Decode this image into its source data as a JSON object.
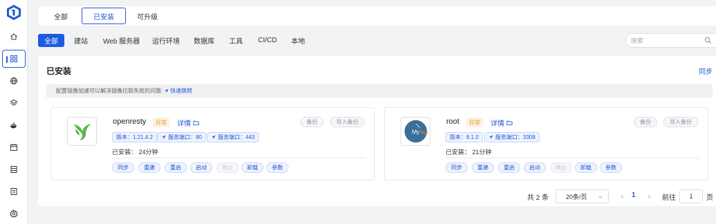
{
  "sidebar": {
    "items": [
      {
        "icon": "home-icon"
      },
      {
        "icon": "apps-grid-icon",
        "active": true
      },
      {
        "icon": "globe-icon"
      },
      {
        "icon": "layers-icon"
      },
      {
        "icon": "docker-icon"
      },
      {
        "icon": "calendar-icon"
      },
      {
        "icon": "database-icon"
      },
      {
        "icon": "log-icon"
      },
      {
        "icon": "settings-icon"
      }
    ]
  },
  "top_tabs": [
    {
      "label": "全部"
    },
    {
      "label": "已安装",
      "active": true
    },
    {
      "label": "可升级"
    }
  ],
  "filters": [
    {
      "label": "全部",
      "active": true
    },
    {
      "label": "建站"
    },
    {
      "label": "Web 服务器"
    },
    {
      "label": "运行环境"
    },
    {
      "label": "数据库"
    },
    {
      "label": "工具"
    },
    {
      "label": "CI/CD"
    },
    {
      "label": "本地"
    }
  ],
  "search": {
    "placeholder": "搜索"
  },
  "panel": {
    "title": "已安装",
    "sync": "同步",
    "tip": "配置镜像加速可以解决镜像拉取失败的问题",
    "tip_link": "快速跳转"
  },
  "apps": [
    {
      "name": "openresty",
      "status": "异常",
      "detail": "详情",
      "version": "版本：1.21.4.2",
      "ports": [
        "服务端口：80",
        "服务端口：443"
      ],
      "installed": "已安装：  24分钟",
      "backup": "备份",
      "import_backup": "导入备份",
      "actions": [
        "同步",
        "重建",
        "重启",
        "启动",
        "停止",
        "卸载",
        "参数"
      ]
    },
    {
      "name": "root",
      "status": "异常",
      "detail": "详情",
      "version": "版本：8.1.0",
      "ports": [
        "服务端口：3308"
      ],
      "installed": "已安装：  21分钟",
      "backup": "备份",
      "import_backup": "导入备份",
      "actions": [
        "同步",
        "重建",
        "重启",
        "启动",
        "停止",
        "卸载",
        "参数"
      ]
    }
  ],
  "pager": {
    "total": "共 2 条",
    "page_size": "20条/页",
    "current": "1",
    "goto_label": "前往",
    "goto_value": "1",
    "page_suffix": "页"
  },
  "colors": {
    "accent": "#1f57d6",
    "warning": "#e6a23c",
    "openresty_green": "#58b948",
    "mysql_blue": "#3d6e98"
  }
}
